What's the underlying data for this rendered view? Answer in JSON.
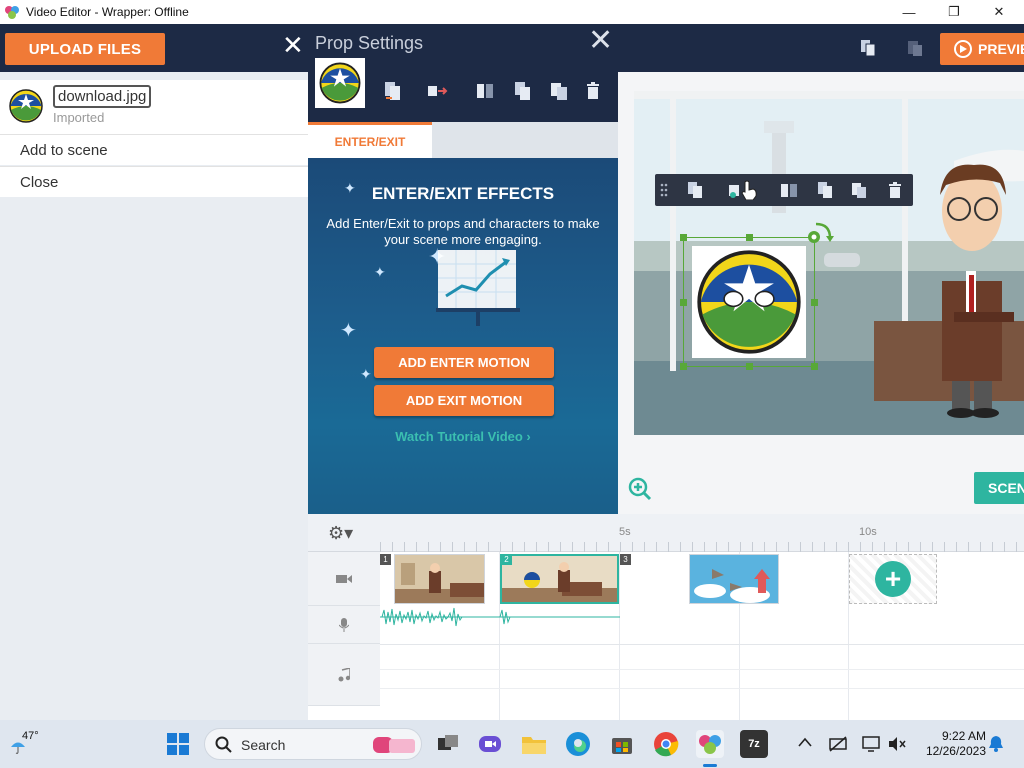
{
  "window": {
    "title": "Video Editor - Wrapper: Offline",
    "minimize": "—",
    "maximize": "❐",
    "close": "✕"
  },
  "topbar": {
    "upload_label": "UPLOAD FILES",
    "close_glyph": "✕",
    "preview_label": "PREVIE"
  },
  "asset": {
    "name": "download.jpg",
    "status": "Imported",
    "menu": [
      "Add to scene",
      "Close"
    ]
  },
  "prop_settings": {
    "title": "Prop Settings",
    "close_glyph": "✕",
    "tab": "ENTER/EXIT",
    "effects_title": "ENTER/EXIT EFFECTS",
    "effects_desc": "Add Enter/Exit to props and characters to make your scene more engaging.",
    "enter_button": "ADD ENTER MOTION",
    "exit_button": "ADD EXIT MOTION",
    "tutorial_link": "Watch Tutorial Video ›"
  },
  "stage": {
    "scene_button": "SCEN"
  },
  "timeline": {
    "ticks": [
      "5s",
      "10s"
    ],
    "settings_glyph": "⚙▾",
    "clip_numbers": [
      "1",
      "2",
      "3"
    ],
    "add_glyph": "+",
    "row_icons": [
      "video-camera-icon",
      "microphone-icon",
      "music-note-icon"
    ]
  },
  "taskbar": {
    "temperature": "47°",
    "search_label": "Search",
    "time": "9:22 AM",
    "date": "12/26/2023"
  },
  "colors": {
    "accent": "#f07a37",
    "navy": "#1d2a45",
    "teal": "#2eb5a0",
    "selection": "#58a838"
  }
}
